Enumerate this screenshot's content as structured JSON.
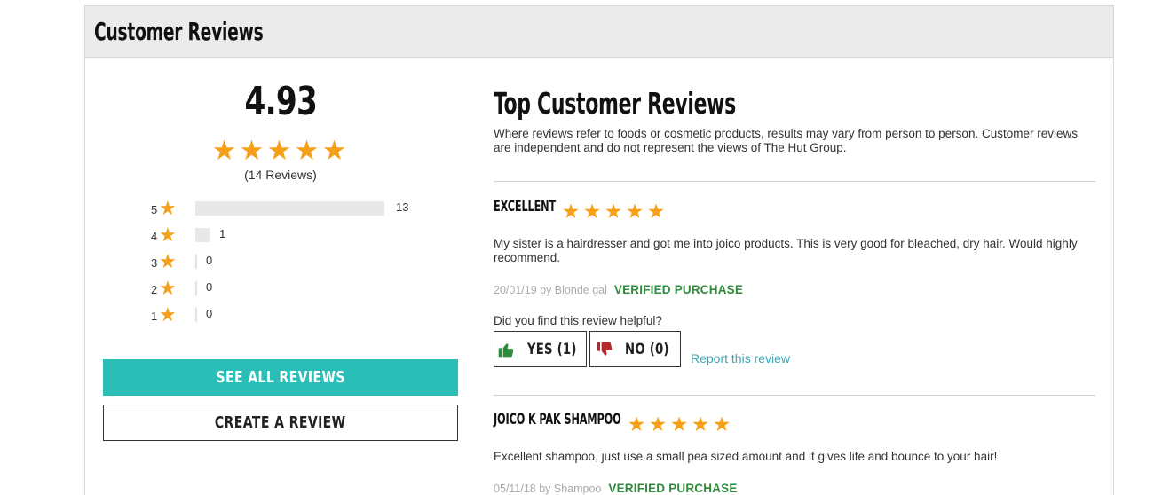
{
  "header": {
    "title": "Customer Reviews"
  },
  "summary": {
    "average": "4.93",
    "rating_stars": 5,
    "review_count_text": "(14 Reviews)",
    "distribution": [
      {
        "label": "5",
        "count": "13",
        "fraction": 1.0
      },
      {
        "label": "4",
        "count": "1",
        "fraction": 0.08
      },
      {
        "label": "3",
        "count": "0",
        "fraction": 0
      },
      {
        "label": "2",
        "count": "0",
        "fraction": 0
      },
      {
        "label": "1",
        "count": "0",
        "fraction": 0
      }
    ],
    "see_all_label": "SEE ALL REVIEWS",
    "create_label": "CREATE A REVIEW"
  },
  "top_reviews": {
    "title": "Top Customer Reviews",
    "disclaimer": "Where reviews refer to foods or cosmetic products, results may vary from person to person. Customer reviews are independent and do not represent the views of The Hut Group.",
    "reviews": [
      {
        "title": "EXCELLENT",
        "stars": 5,
        "body": "My sister is a hairdresser and got me into joico products. This is very good for bleached, dry hair. Would highly recommend.",
        "meta": "20/01/19 by Blonde gal",
        "verified": "VERIFIED PURCHASE",
        "helpful_question": "Did you find this review helpful?",
        "yes_label": "YES (1)",
        "no_label": "NO (0)",
        "report_label": "Report this review"
      },
      {
        "title": "JOICO K PAK SHAMPOO",
        "stars": 5,
        "body": "Excellent shampoo, just use a small pea sized amount and it gives life and bounce to your hair!",
        "meta": "05/11/18 by Shampoo",
        "verified": "VERIFIED PURCHASE"
      }
    ]
  },
  "colors": {
    "star": "#f6a01a",
    "accent_teal": "#2bbeb7",
    "verified_green": "#2f8a3b",
    "link": "#3aa8b8",
    "thumb_up": "#2f8a3b",
    "thumb_down": "#b22b2b"
  },
  "icons": [
    "star-icon",
    "thumbs-up-icon",
    "thumbs-down-icon"
  ]
}
